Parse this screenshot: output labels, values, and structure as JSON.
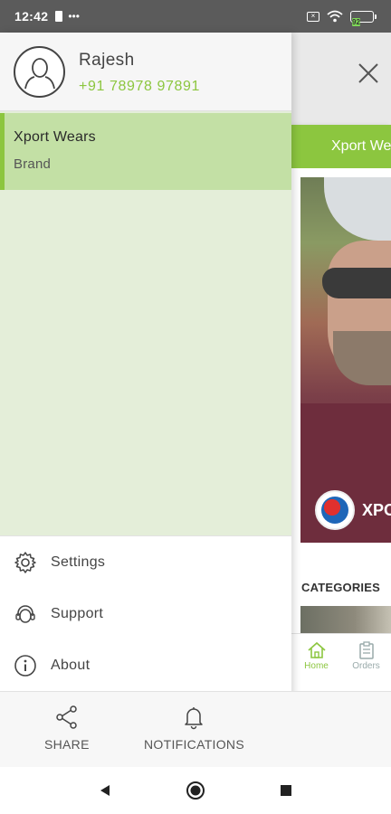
{
  "status_bar": {
    "time": "12:42",
    "dots": "•••",
    "battery_level": "92"
  },
  "drawer": {
    "user": {
      "name": "Rajesh",
      "phone": "+91 78978 97891"
    },
    "items": [
      {
        "title": "Xport Wears",
        "subtitle": "Brand",
        "selected": true
      }
    ],
    "menu": [
      {
        "label": "Settings",
        "icon": "gear-icon"
      },
      {
        "label": "Support",
        "icon": "headset-icon"
      },
      {
        "label": "About",
        "icon": "info-icon"
      }
    ],
    "footer": [
      {
        "label": "SHARE",
        "icon": "share-icon"
      },
      {
        "label": "NOTIFICATIONS",
        "icon": "bell-icon"
      }
    ]
  },
  "background_app": {
    "toolbar_title": "Xport Wears",
    "brand_text": "XPORT",
    "categories_label": "CATEGORIES",
    "bottom_nav": [
      {
        "label": "Home",
        "icon": "home-icon",
        "active": true
      },
      {
        "label": "Orders",
        "icon": "orders-icon",
        "active": false
      }
    ]
  },
  "colors": {
    "accent": "#8cc63f",
    "selected_item_bg": "#c3e0a5",
    "drawer_list_bg": "#e4eed9",
    "status_bar": "#5b5b5b"
  }
}
